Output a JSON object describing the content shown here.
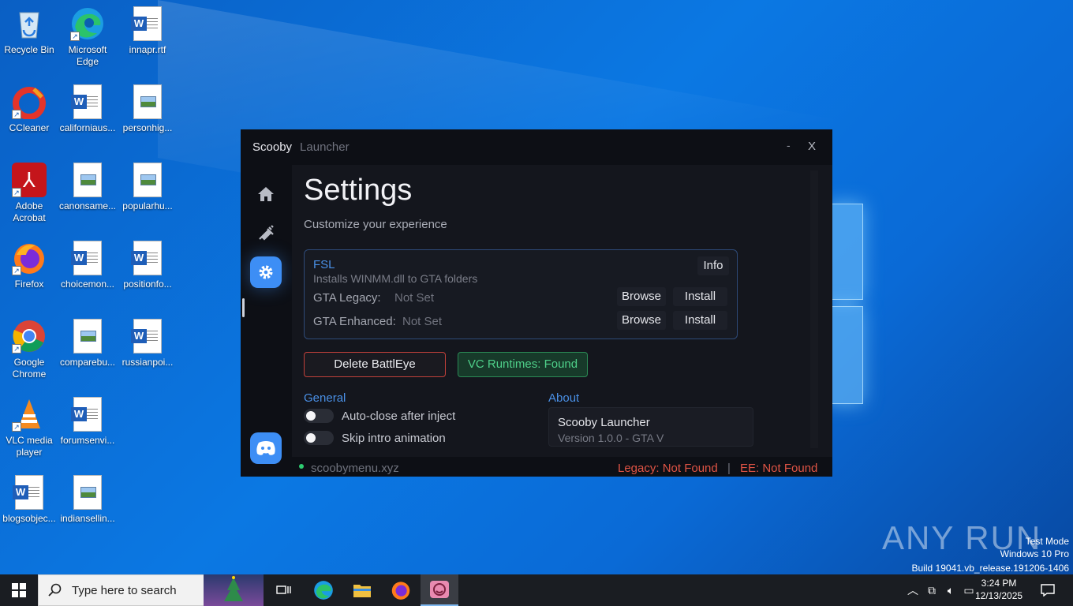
{
  "desktop": {
    "icons": [
      {
        "label": "Recycle Bin"
      },
      {
        "label": "Microsoft Edge"
      },
      {
        "label": "innapr.rtf"
      },
      {
        "label": "CCleaner"
      },
      {
        "label": "californiaus..."
      },
      {
        "label": "personhig..."
      },
      {
        "label": "Adobe Acrobat"
      },
      {
        "label": "canonsame..."
      },
      {
        "label": "popularhu..."
      },
      {
        "label": "Firefox"
      },
      {
        "label": "choicemon..."
      },
      {
        "label": "positionfo..."
      },
      {
        "label": "Google Chrome"
      },
      {
        "label": "comparebu..."
      },
      {
        "label": "russianpoi..."
      },
      {
        "label": "VLC media player"
      },
      {
        "label": "forumsenvi..."
      },
      {
        "label": "blogsobjec..."
      },
      {
        "label": "indiansellin..."
      }
    ]
  },
  "app": {
    "title": "Scooby",
    "subtitle": "Launcher",
    "minimize": "-",
    "close": "X",
    "nav": [
      "home-icon",
      "syringe-icon",
      "gear-icon",
      "discord-icon"
    ],
    "settings": {
      "heading": "Settings",
      "subheading": "Customize your experience",
      "fsl": {
        "title": "FSL",
        "desc": "Installs WINMM.dll to GTA folders",
        "info": "Info",
        "rows": [
          {
            "label": "GTA Legacy:",
            "value": "Not Set",
            "browse": "Browse",
            "install": "Install"
          },
          {
            "label": "GTA Enhanced:",
            "value": "Not Set",
            "browse": "Browse",
            "install": "Install"
          }
        ]
      },
      "delete_battleye": "Delete BattlEye",
      "vc_runtimes": "VC Runtimes: Found",
      "general": {
        "heading": "General",
        "toggles": [
          {
            "label": "Auto-close after inject",
            "on": false
          },
          {
            "label": "Skip intro animation",
            "on": false
          }
        ]
      },
      "about": {
        "heading": "About",
        "name": "Scooby Launcher",
        "version": "Version 1.0.0 - GTA V"
      }
    },
    "footer": {
      "site": "scoobymenu.xyz",
      "legacy": "Legacy: Not Found",
      "sep": "|",
      "ee": "EE: Not Found"
    }
  },
  "watermark": {
    "brand": "ANY RUN",
    "line1": "Test Mode",
    "line2": "Windows 10 Pro",
    "line3": "Build 19041.vb_release.191206-1406"
  },
  "taskbar": {
    "search_placeholder": "Type here to search",
    "time": "3:24 PM",
    "date": "12/13/2025",
    "colors": {
      "accent": "#3d8ef5",
      "danger": "#e05445",
      "success": "#4fd08a"
    }
  }
}
